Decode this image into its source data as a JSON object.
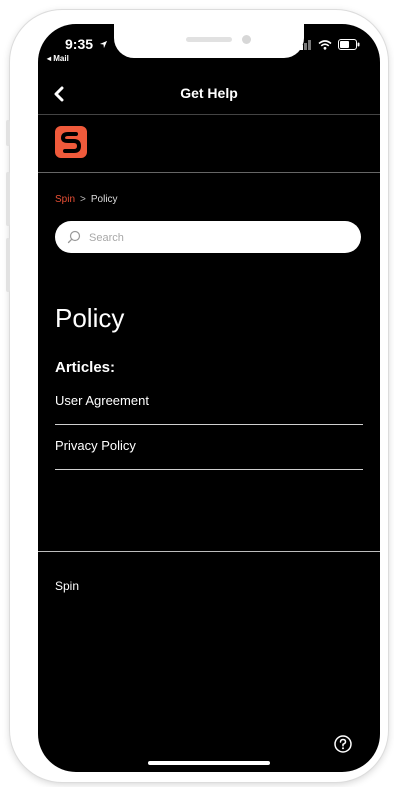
{
  "status_bar": {
    "time": "9:35",
    "back_app": "Mail"
  },
  "nav": {
    "title": "Get Help"
  },
  "breadcrumb": {
    "home": "Spin",
    "separator": ">",
    "current": "Policy"
  },
  "search": {
    "placeholder": "Search"
  },
  "section": {
    "title": "Policy",
    "articles_heading": "Articles:",
    "articles": [
      {
        "label": "User Agreement"
      },
      {
        "label": "Privacy Policy"
      }
    ]
  },
  "footer": {
    "text": "Spin"
  },
  "colors": {
    "accent": "#f05a3b",
    "background": "#000000"
  },
  "icons": [
    "back-chevron-icon",
    "spin-logo-icon",
    "search-icon",
    "help-icon",
    "signal-icon",
    "wifi-icon",
    "battery-icon",
    "location-arrow-icon"
  ]
}
